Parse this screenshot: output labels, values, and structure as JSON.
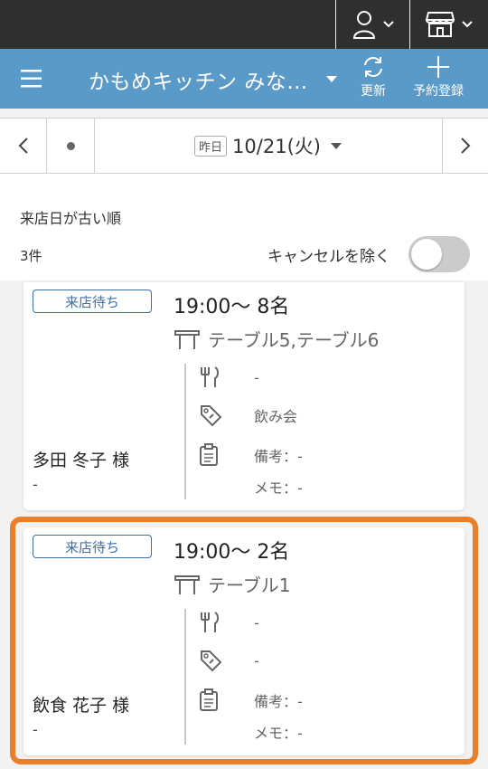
{
  "colors": {
    "topbar": "#2f2f2f",
    "appbar": "#5a9ac8",
    "badge": "#3f6fa8",
    "highlight": "#e97f2b"
  },
  "header": {
    "title": "かもめキッチン みな…",
    "refresh_label": "更新",
    "add_label": "予約登録"
  },
  "datebar": {
    "yesterday": "昨日",
    "date": "10/21(火)"
  },
  "filter": {
    "sort": "来店日が古い順",
    "count": "3件",
    "cancel_label": "キャンセルを除く",
    "exclude_cancel": false
  },
  "reservations": [
    {
      "status": "来店待ち",
      "time": "19:00〜 8名",
      "tables": "テーブル5,テーブル6",
      "course": "-",
      "tag": "飲み会",
      "note": "備考：-",
      "memo": "メモ：-",
      "name": "多田 冬子 様",
      "sub": "-"
    },
    {
      "status": "来店待ち",
      "time": "19:00〜 2名",
      "tables": "テーブル1",
      "course": "-",
      "tag": "-",
      "note": "備考：-",
      "memo": "メモ：-",
      "name": "飲食 花子 様",
      "sub": "-"
    }
  ]
}
